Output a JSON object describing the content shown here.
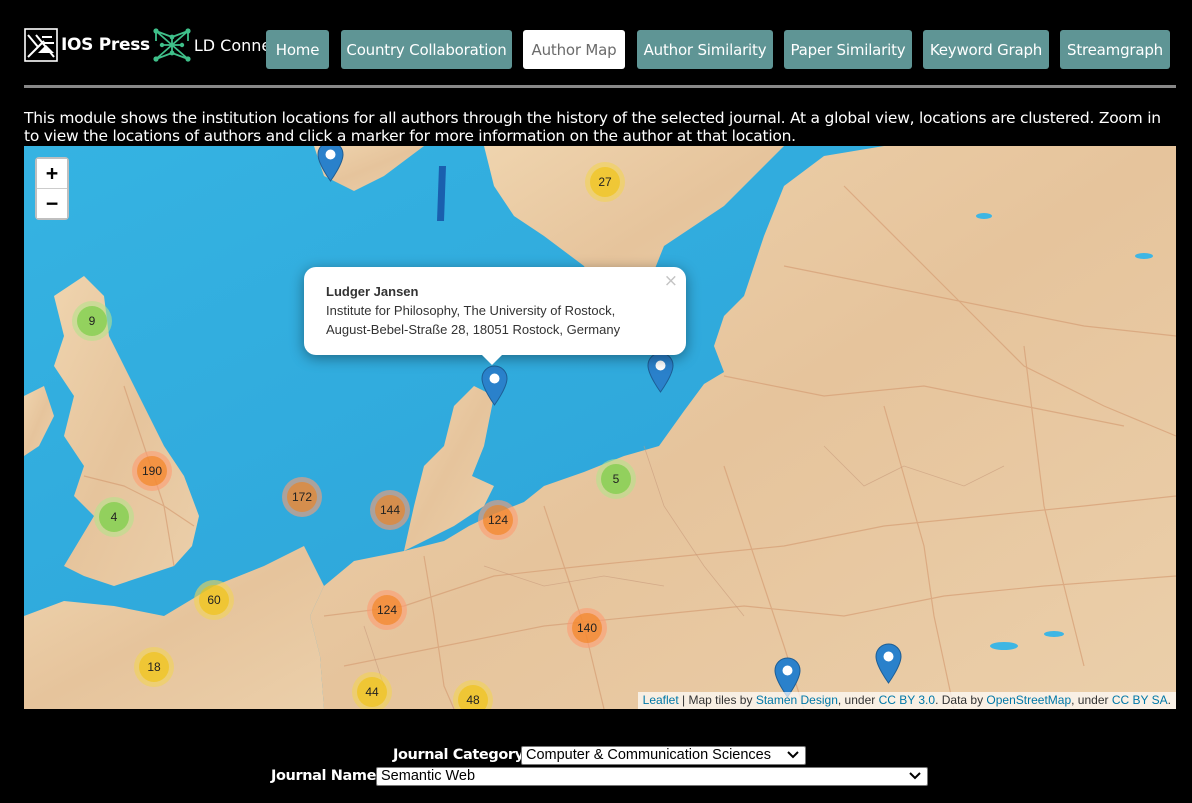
{
  "header": {
    "logo_ios_text": "IOS Press",
    "logo_ld_text": "LD Connect",
    "nav": [
      {
        "label": "Home",
        "active": false
      },
      {
        "label": "Country Collaboration",
        "active": false
      },
      {
        "label": "Author Map",
        "active": true
      },
      {
        "label": "Author Similarity",
        "active": false
      },
      {
        "label": "Paper Similarity",
        "active": false
      },
      {
        "label": "Keyword Graph",
        "active": false
      },
      {
        "label": "Streamgraph",
        "active": false
      }
    ]
  },
  "intro": "This module shows the institution locations for all authors through the history of the selected journal. At a global view, locations are clustered. Zoom in to view the locations of authors and click a marker for more information on the author at that location.",
  "map": {
    "zoom_in": "+",
    "zoom_out": "−",
    "clusters": [
      {
        "count": "27",
        "size": "medium"
      },
      {
        "count": "9",
        "size": "small"
      },
      {
        "count": "190",
        "size": "large"
      },
      {
        "count": "4",
        "size": "small"
      },
      {
        "count": "172",
        "size": "large"
      },
      {
        "count": "144",
        "size": "large"
      },
      {
        "count": "124",
        "size": "large"
      },
      {
        "count": "5",
        "size": "small"
      },
      {
        "count": "60",
        "size": "medium"
      },
      {
        "count": "124",
        "size": "large"
      },
      {
        "count": "140",
        "size": "large"
      },
      {
        "count": "18",
        "size": "medium"
      },
      {
        "count": "44",
        "size": "medium"
      },
      {
        "count": "48",
        "size": "medium"
      }
    ],
    "popup": {
      "name": "Ludger Jansen",
      "line1": "Institute for Philosophy, The University of Rostock,",
      "line2": "August-Bebel-Straße 28, 18051 Rostock, Germany",
      "close": "×"
    },
    "attribution": {
      "leaflet": "Leaflet",
      "sep1": " | Map tiles by ",
      "stamen": "Stamen Design",
      "sep2": ", under ",
      "ccby": "CC BY 3.0",
      "sep3": ". Data by ",
      "osm": "OpenStreetMap",
      "sep4": ", under ",
      "ccbysa": "CC BY SA",
      "end": "."
    },
    "colors": {
      "water": "#2fa9dc",
      "land": "#e8c9a3",
      "marker": "#2a81cb"
    }
  },
  "selectors": {
    "category_label": "Journal Category:",
    "category_value": "Computer & Communication Sciences",
    "name_label": "Journal Name:",
    "name_value": "Semantic Web"
  }
}
